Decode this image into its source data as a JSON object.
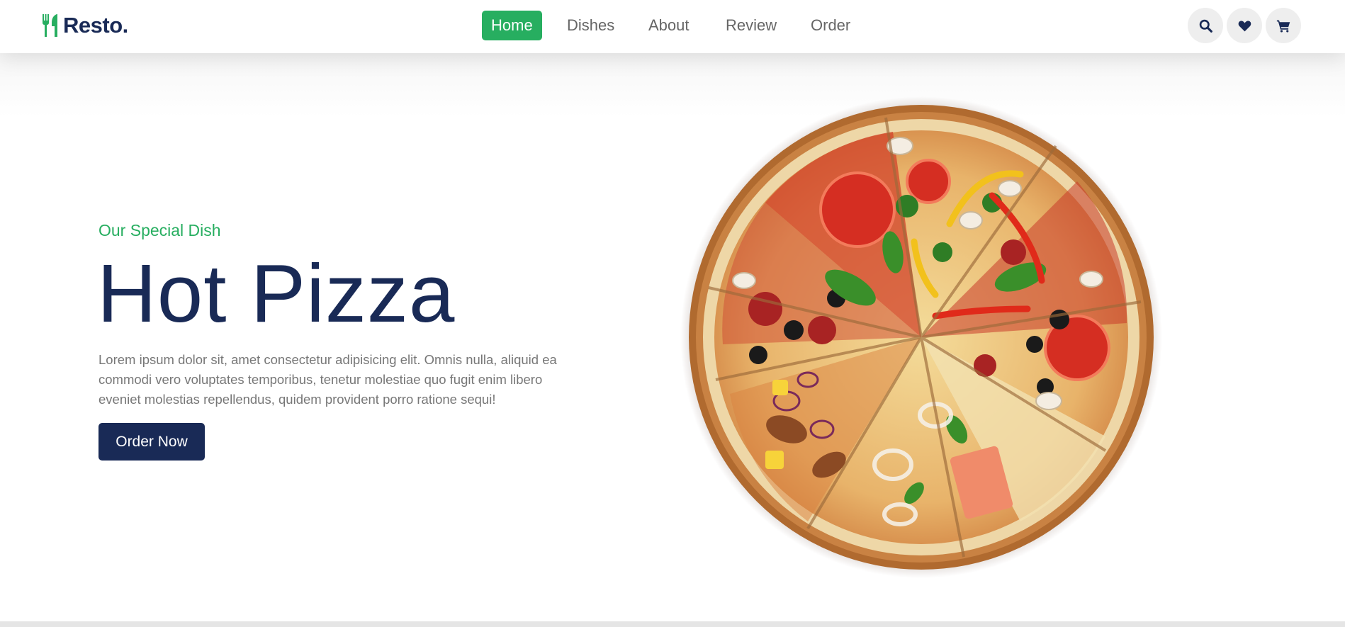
{
  "header": {
    "logo_text": "Resto.",
    "nav": [
      {
        "label": "Home",
        "active": true
      },
      {
        "label": "Dishes",
        "active": false
      },
      {
        "label": "About",
        "active": false
      },
      {
        "label": "Review",
        "active": false
      },
      {
        "label": "Order",
        "active": false
      }
    ],
    "icons": [
      "search-icon",
      "heart-icon",
      "cart-icon"
    ]
  },
  "hero": {
    "subtitle": "Our Special Dish",
    "title": "Hot Pizza",
    "description": "Lorem ipsum dolor sit, amet consectetur adipisicing elit. Omnis nulla, aliquid ea commodi vero voluptates temporibus, tenetur molestiae quo fugit enim libero eveniet molestias repellendus, quidem provident porro ratione sequi!",
    "button_label": "Order Now",
    "image": "pizza-image"
  },
  "colors": {
    "accent": "#27ae60",
    "brand": "#192a56",
    "text_muted": "#777777"
  }
}
